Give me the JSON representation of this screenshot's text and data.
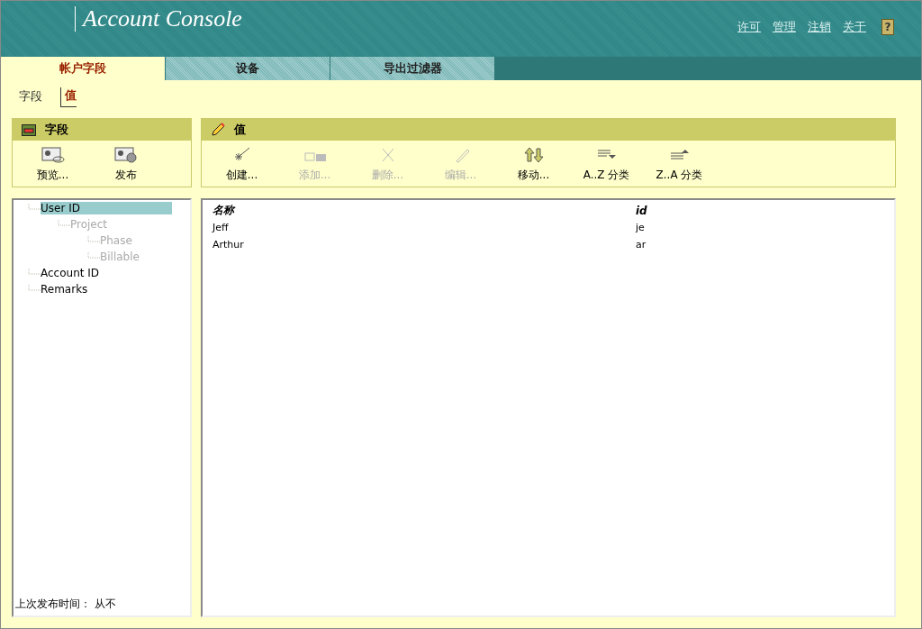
{
  "header": {
    "title": "Account Console",
    "links": [
      "许可",
      "管理",
      "注销",
      "关于"
    ],
    "help": "?"
  },
  "tabs": [
    {
      "label": "帐户字段",
      "selected": true
    },
    {
      "label": "设备",
      "selected": false
    },
    {
      "label": "导出过滤器",
      "selected": false
    }
  ],
  "subtabs": [
    {
      "label": "字段",
      "selected": false
    },
    {
      "label": "值",
      "selected": true
    }
  ],
  "fields_panel": {
    "title": "字段",
    "actions": [
      {
        "label": "预览...",
        "kind": "preview",
        "disabled": false
      },
      {
        "label": "发布",
        "kind": "publish",
        "disabled": false
      }
    ]
  },
  "values_panel": {
    "title": "值",
    "actions": [
      {
        "label": "创建...",
        "kind": "create",
        "disabled": false
      },
      {
        "label": "添加...",
        "kind": "add",
        "disabled": true
      },
      {
        "label": "删除...",
        "kind": "delete",
        "disabled": true
      },
      {
        "label": "编辑...",
        "kind": "edit",
        "disabled": true
      },
      {
        "label": "移动...",
        "kind": "move",
        "disabled": false
      },
      {
        "label": "A..Z 分类",
        "kind": "sortup",
        "disabled": false
      },
      {
        "label": "Z..A 分类",
        "kind": "sortdown",
        "disabled": false
      }
    ]
  },
  "tree": [
    {
      "label": "User ID",
      "selected": true,
      "disabled": false,
      "children": [
        {
          "label": "Project",
          "selected": false,
          "disabled": true,
          "children": [
            {
              "label": "Phase",
              "selected": false,
              "disabled": true
            },
            {
              "label": "Billable",
              "selected": false,
              "disabled": true
            }
          ]
        }
      ]
    },
    {
      "label": "Account ID",
      "selected": false,
      "disabled": false
    },
    {
      "label": "Remarks",
      "selected": false,
      "disabled": false
    }
  ],
  "last_published": "上次发布时间： 从不",
  "table": {
    "columns": [
      "名称",
      "id"
    ],
    "rows": [
      [
        "Jeff",
        "je"
      ],
      [
        "Arthur",
        "ar"
      ]
    ]
  }
}
